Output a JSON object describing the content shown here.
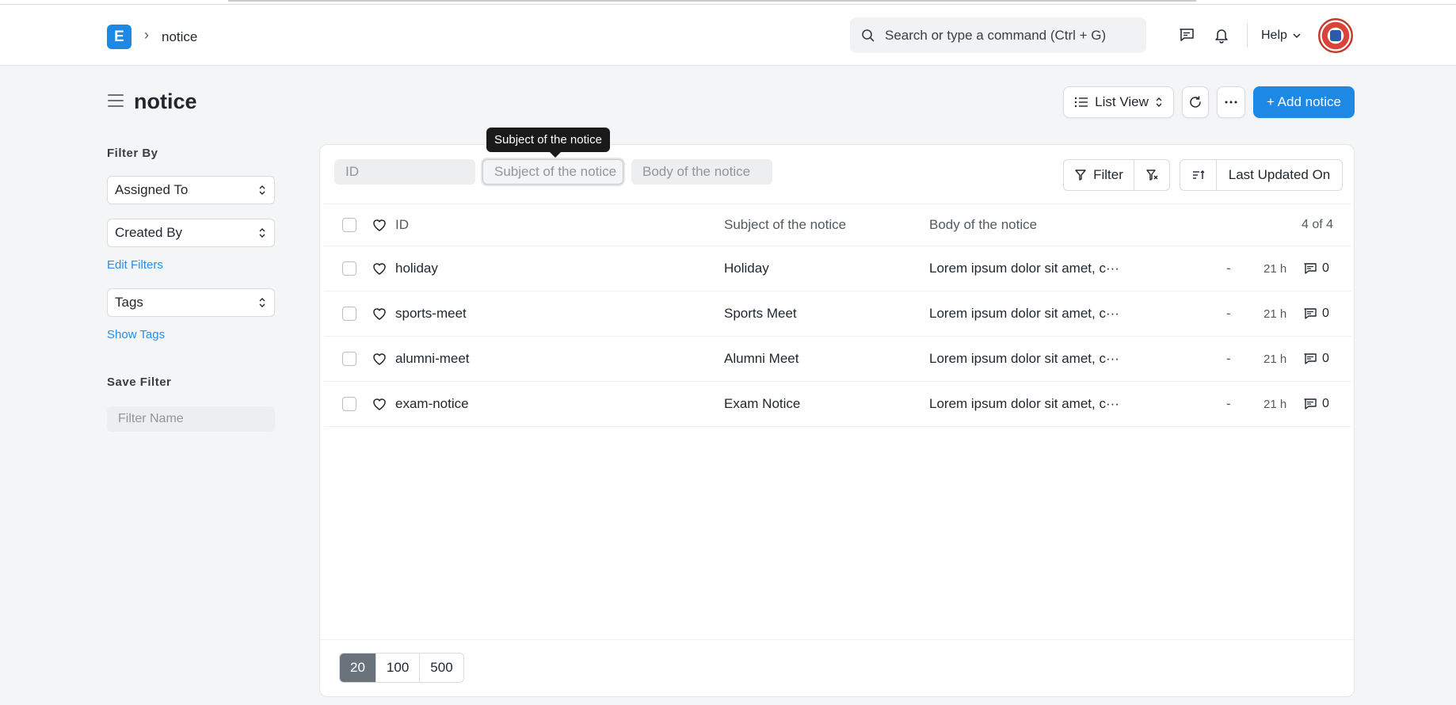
{
  "navbar": {
    "logo_letter": "E",
    "breadcrumb": "notice",
    "search_placeholder": "Search or type a command (Ctrl + G)",
    "help_label": "Help"
  },
  "page": {
    "title": "notice",
    "list_view_label": "List View",
    "add_button_label": "+ Add notice"
  },
  "sidebar": {
    "filter_by_heading": "Filter By",
    "assigned_to": "Assigned To",
    "created_by": "Created By",
    "edit_filters": "Edit Filters",
    "tags": "Tags",
    "show_tags": "Show Tags",
    "save_filter_heading": "Save Filter",
    "filter_name_placeholder": "Filter Name"
  },
  "filters": {
    "id_placeholder": "ID",
    "subject_placeholder": "Subject of the notice",
    "body_placeholder": "Body of the notice",
    "tooltip": "Subject of the notice",
    "filter_label": "Filter",
    "sort_label": "Last Updated On"
  },
  "list": {
    "columns": {
      "id": "ID",
      "subject": "Subject of the notice",
      "body": "Body of the notice",
      "count": "4 of 4"
    },
    "rows": [
      {
        "id": "holiday",
        "subject": "Holiday",
        "body": "Lorem ipsum dolor sit amet, c···",
        "dash": "-",
        "time": "21 h",
        "comments": "0"
      },
      {
        "id": "sports-meet",
        "subject": "Sports Meet",
        "body": "Lorem ipsum dolor sit amet, c···",
        "dash": "-",
        "time": "21 h",
        "comments": "0"
      },
      {
        "id": "alumni-meet",
        "subject": "Alumni Meet",
        "body": "Lorem ipsum dolor sit amet, c···",
        "dash": "-",
        "time": "21 h",
        "comments": "0"
      },
      {
        "id": "exam-notice",
        "subject": "Exam Notice",
        "body": "Lorem ipsum dolor sit amet, c···",
        "dash": "-",
        "time": "21 h",
        "comments": "0"
      }
    ]
  },
  "pager": {
    "options": [
      "20",
      "100",
      "500"
    ],
    "active": "20"
  },
  "colors": {
    "primary": "#1e88e5",
    "link": "#2490ef",
    "pager_active": "#6a737b"
  }
}
